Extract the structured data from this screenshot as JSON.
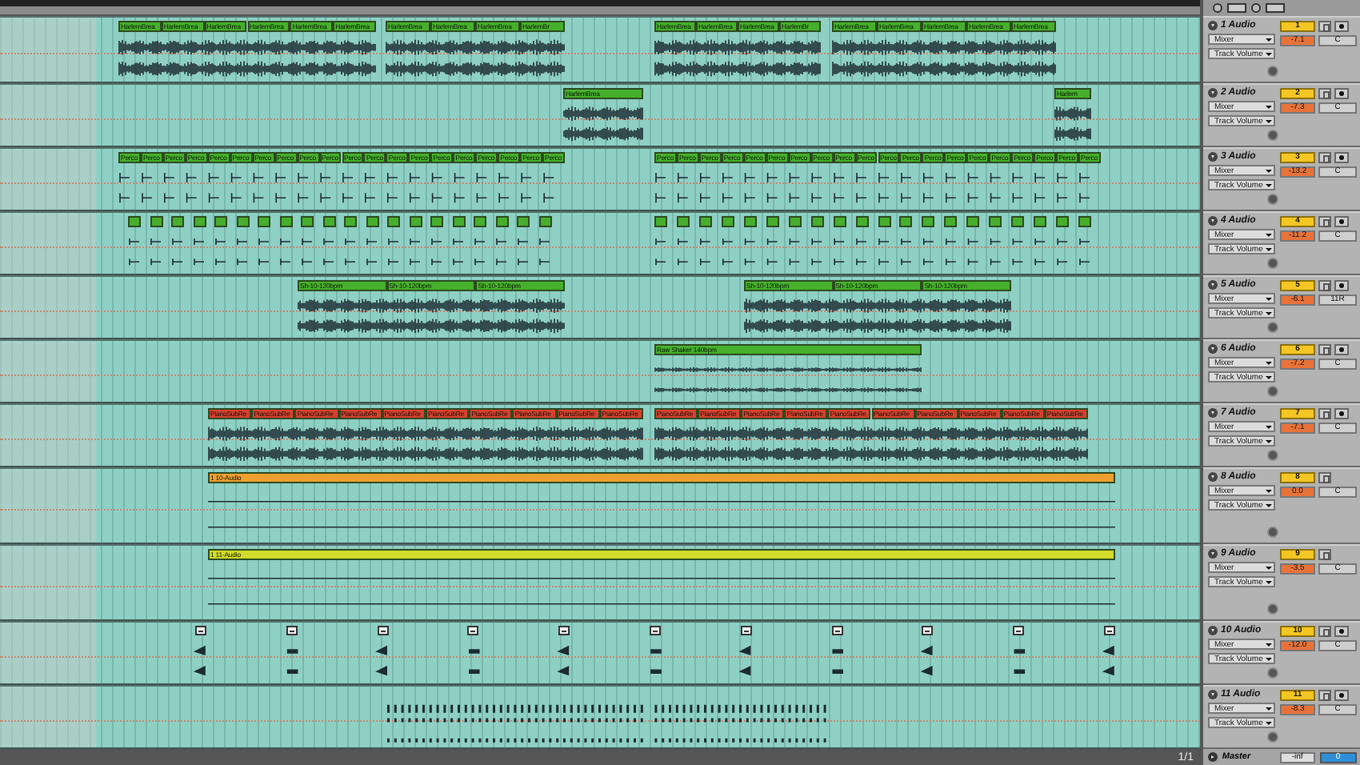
{
  "arrangement": {
    "position": "1/1"
  },
  "tracks": [
    {
      "name": "1 Audio",
      "number": "1",
      "volume": "-7.1",
      "pan": "C",
      "device": "Mixer",
      "parameter": "Track Volume",
      "arm": true,
      "color": "#46b02c",
      "clips": [
        "HarlemBrea",
        "HarlemBrea",
        "HarlemBrea",
        "HarlemBrea",
        "HarlemBrea",
        "HarlemBrea",
        "HarlemBrea",
        "HarlemBrea",
        "HarlemBrea",
        "HarlemBr",
        "HarlemBrea",
        "HarlemBrea",
        "HarlemBrea",
        "HarlemBr",
        "HarlemBrea",
        "HarlemBrea",
        "HarlemBrea",
        "HarlemBrea",
        "HarlemBrea"
      ]
    },
    {
      "name": "2 Audio",
      "number": "2",
      "volume": "-7.3",
      "pan": "C",
      "device": "Mixer",
      "parameter": "Track Volume",
      "arm": true,
      "color": "#46b02c",
      "clips": [
        "HarlemBrea",
        "Harlem"
      ]
    },
    {
      "name": "3 Audio",
      "number": "3",
      "volume": "-13.2",
      "pan": "C",
      "device": "Mixer",
      "parameter": "Track Volume",
      "arm": true,
      "color": "#46b02c",
      "clips": [
        "Perco",
        "Perco",
        "Perco",
        "Perco",
        "Perco",
        "Perco",
        "Perco",
        "Perco",
        "Perco",
        "Perco",
        "Perco",
        "Perco",
        "Perco",
        "Perco",
        "Perco",
        "Perco",
        "Perco",
        "Perco",
        "Perco",
        "Perco",
        "Perco",
        "Perco",
        "Perco",
        "Perco",
        "Perco",
        "Perco",
        "Perco",
        "Perco",
        "Perco",
        "Perco",
        "Perco",
        "Perco",
        "Perco",
        "Perco",
        "Perco",
        "Perco",
        "Perco",
        "Perco",
        "Perco",
        "Perco"
      ]
    },
    {
      "name": "4 Audio",
      "number": "4",
      "volume": "-11.2",
      "pan": "C",
      "device": "Mixer",
      "parameter": "Track Volume",
      "arm": true,
      "color": "#46b02c"
    },
    {
      "name": "5 Audio",
      "number": "5",
      "volume": "-6.1",
      "pan": "11R",
      "device": "Mixer",
      "parameter": "Track Volume",
      "arm": true,
      "color": "#46b02c",
      "clips": [
        "Sh-10-120bpm",
        "Sh-10-120bpm",
        "Sh-10-120bpm",
        "Sh-10-120bpm",
        "Sh-10-120bpm",
        "Sh-10-120bpm"
      ]
    },
    {
      "name": "6 Audio",
      "number": "6",
      "volume": "-7.2",
      "pan": "C",
      "device": "Mixer",
      "parameter": "Track Volume",
      "arm": true,
      "color": "#46b02c",
      "clips": [
        "Raw Shaker 140bpm"
      ]
    },
    {
      "name": "7 Audio",
      "number": "7",
      "volume": "-7.1",
      "pan": "C",
      "device": "Mixer",
      "parameter": "Track Volume",
      "arm": true,
      "color": "#d8402e",
      "clips": [
        "PianoSubRe",
        "PianoSubRe",
        "PianoSubRe",
        "PianoSubRe",
        "PianoSubRe",
        "PianoSubRe",
        "PianoSubRe",
        "PianoSubRe",
        "PianoSubRe",
        "PianoSubRe",
        "PianoSubRe",
        "PianoSubRe",
        "PianoSubRe",
        "PianoSubRe",
        "PianoSubRe",
        "PianoSubRe",
        "PianoSubRe",
        "PianoSubRe",
        "PianoSubRe",
        "PianoSubRe"
      ]
    },
    {
      "name": "8 Audio",
      "number": "8",
      "volume": "0.0",
      "pan": "C",
      "device": "Mixer",
      "parameter": "Track Volume",
      "arm": false,
      "color": "#f0a030",
      "clips": [
        "1 10-Audio"
      ]
    },
    {
      "name": "9 Audio",
      "number": "9",
      "volume": "-3.5",
      "pan": "C",
      "device": "Mixer",
      "parameter": "Track Volume",
      "arm": false,
      "color": "#d2dc2a",
      "clips": [
        "1 11-Audio"
      ]
    },
    {
      "name": "10 Audio",
      "number": "10",
      "volume": "-12.0",
      "pan": "C",
      "device": "Mixer",
      "parameter": "Track Volume",
      "arm": true,
      "color": "#f2f2f2"
    },
    {
      "name": "11 Audio",
      "number": "11",
      "volume": "-8.3",
      "pan": "C",
      "device": "Mixer",
      "parameter": "Track Volume",
      "arm": true
    }
  ],
  "master": {
    "name": "Master",
    "volume": "-inf",
    "pan": "0"
  }
}
